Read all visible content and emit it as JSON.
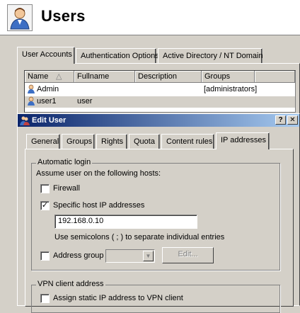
{
  "page": {
    "title": "Users"
  },
  "main_tabs": [
    {
      "label": "User Accounts"
    },
    {
      "label": "Authentication Options"
    },
    {
      "label": "Active Directory / NT Domain"
    }
  ],
  "user_list": {
    "columns": [
      "Name",
      "Fullname",
      "Description",
      "Groups"
    ],
    "rows": [
      {
        "name": "Admin",
        "fullname": "",
        "description": "",
        "groups": "[administrators]"
      },
      {
        "name": "user1",
        "fullname": "user",
        "description": "",
        "groups": ""
      }
    ]
  },
  "dialog": {
    "title": "Edit User",
    "help_label": "?",
    "close_label": "✕",
    "tabs": [
      {
        "label": "General"
      },
      {
        "label": "Groups"
      },
      {
        "label": "Rights"
      },
      {
        "label": "Quota"
      },
      {
        "label": "Content rules"
      },
      {
        "label": "IP addresses"
      }
    ],
    "automatic_login": {
      "title": "Automatic login",
      "description": "Assume user on the following hosts:",
      "firewall_label": "Firewall",
      "firewall_checked": false,
      "specific_label": "Specific host IP addresses",
      "specific_checked": true,
      "ip_value": "192.168.0.10",
      "hint": "Use semicolons ( ; ) to separate individual entries",
      "address_group_label": "Address group",
      "address_group_checked": false,
      "address_group_value": "",
      "edit_label": "Edit..."
    },
    "vpn": {
      "title": "VPN client address",
      "assign_label": "Assign static IP address to VPN client",
      "assign_checked": false
    }
  }
}
